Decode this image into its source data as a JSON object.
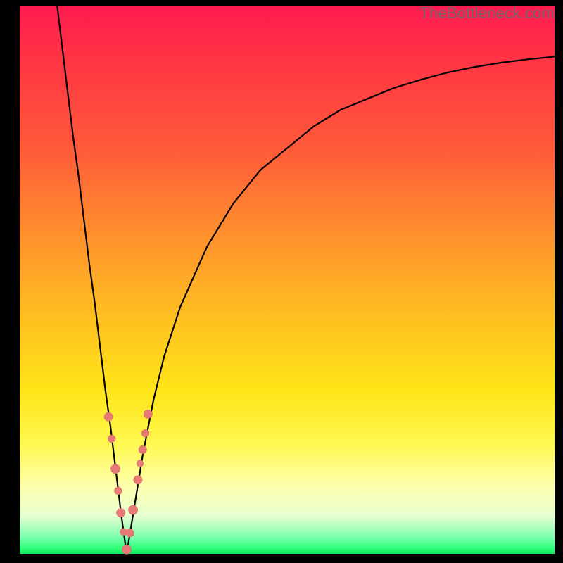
{
  "watermark": "TheBottleneck.com",
  "colors": {
    "curve": "#000000",
    "marker_fill": "#e77a74",
    "marker_stroke": "#d46a65",
    "gradient_top": "#ff1a50",
    "gradient_bottom": "#11e858",
    "frame": "#000000"
  },
  "chart_data": {
    "type": "line",
    "title": "",
    "xlabel": "",
    "ylabel": "",
    "xlim": [
      0,
      100
    ],
    "ylim": [
      0,
      100
    ],
    "grid": false,
    "legend": false,
    "notes": "Bottleneck-percentage style V-curve. Minimum (0%) at x≈20. Axes unlabeled in image; values are positional estimates (0–100 both axes).",
    "series": [
      {
        "name": "curve",
        "x": [
          7,
          8,
          9,
          10,
          11,
          12,
          13,
          14,
          15,
          16,
          17,
          18,
          19,
          20,
          21,
          22,
          23,
          24,
          25,
          27,
          30,
          35,
          40,
          45,
          50,
          55,
          60,
          65,
          70,
          75,
          80,
          85,
          90,
          95,
          100
        ],
        "y": [
          100,
          92,
          84,
          76,
          69,
          61,
          53,
          46,
          38,
          30,
          23,
          15,
          7,
          0,
          6,
          12,
          18,
          23,
          28,
          36,
          45,
          56,
          64,
          70,
          74,
          78,
          81,
          83,
          85,
          86.5,
          87.8,
          88.8,
          89.6,
          90.2,
          90.7
        ]
      }
    ],
    "markers": {
      "name": "beads",
      "x": [
        16.6,
        17.2,
        17.9,
        18.4,
        18.9,
        19.4,
        20.0,
        20.6,
        21.2,
        22.1,
        22.5,
        23.0,
        23.5,
        24.0
      ],
      "y": [
        25.0,
        21.0,
        15.5,
        11.5,
        7.5,
        4.0,
        0.8,
        3.8,
        8.0,
        13.5,
        16.5,
        19.0,
        22.0,
        25.5
      ],
      "r": [
        1.5,
        1.3,
        1.6,
        1.3,
        1.5,
        1.2,
        1.6,
        1.4,
        1.6,
        1.5,
        1.2,
        1.4,
        1.3,
        1.5
      ]
    }
  }
}
